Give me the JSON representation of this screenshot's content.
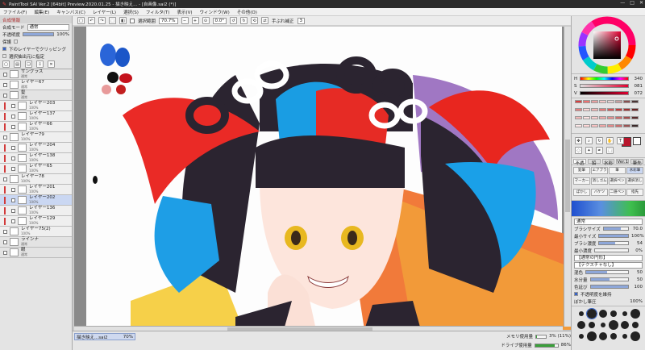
{
  "titlebar": {
    "title": "PaintTool SAI Ver.2 [64bit] Preview.2020.01.25 - 描き映え... - [自画像.sai2 (*)]",
    "min": "—",
    "max": "□",
    "close": "✕"
  },
  "menu": [
    "ファイル(F)",
    "編集(E)",
    "キャンバス(C)",
    "レイヤー(L)",
    "選択(S)",
    "フィルタ(T)",
    "表示(V)",
    "ウィンドウ(W)",
    "その他(O)"
  ],
  "toolbar": {
    "selection_label": "選択範囲",
    "zoom": "70.7%",
    "angle": "0.0°",
    "stabilizer_label": "手ぶれ補正",
    "stabilizer_value": "3"
  },
  "left_panel": {
    "header": "合成情報",
    "blend_label": "合成モード",
    "blend_value": "通常",
    "opacity_label": "不透明度",
    "opacity_value": "100%",
    "guard_label": "保護",
    "clip_label": "下のレイヤーでクリッピング",
    "select_src_label": "選択抽出元に指定",
    "layers": [
      {
        "name": "サングラス",
        "sub": "通常",
        "kind": "folder"
      },
      {
        "name": "レイヤー67",
        "sub": "通常",
        "kind": "normal"
      },
      {
        "name": "髪",
        "sub": "通常",
        "kind": "folder"
      },
      {
        "name": "レイヤー203",
        "sub": "100%",
        "kind": "clip"
      },
      {
        "name": "レイヤー137",
        "sub": "100%",
        "kind": "clip"
      },
      {
        "name": "レイヤー66",
        "sub": "100%",
        "kind": "clip"
      },
      {
        "name": "レイヤー79",
        "sub": "100%",
        "kind": "normal"
      },
      {
        "name": "レイヤー204",
        "sub": "100%",
        "kind": "clip"
      },
      {
        "name": "レイヤー138",
        "sub": "100%",
        "kind": "clip"
      },
      {
        "name": "レイヤー65",
        "sub": "100%",
        "kind": "clip"
      },
      {
        "name": "レイヤー78",
        "sub": "100%",
        "kind": "normal"
      },
      {
        "name": "レイヤー201",
        "sub": "100%",
        "kind": "clip"
      },
      {
        "name": "レイヤー202",
        "sub": "100%",
        "kind": "selected"
      },
      {
        "name": "レイヤー136",
        "sub": "100%",
        "kind": "clip"
      },
      {
        "name": "レイヤー129",
        "sub": "100%",
        "kind": "clip"
      },
      {
        "name": "レイヤー75(2)",
        "sub": "100%",
        "kind": "normal"
      },
      {
        "name": "ラインナ",
        "sub": "通常",
        "kind": "folder"
      },
      {
        "name": "眼",
        "sub": "通常",
        "kind": "folder"
      }
    ]
  },
  "status": {
    "doc_tab": "描き映え...sai2",
    "doc_zoom": "70%",
    "memory_label": "メモリ使用量",
    "memory_value": "3% (11%)",
    "drive_label": "ドライブ使用量",
    "drive_value": "86%"
  },
  "right_panel": {
    "h_label": "H",
    "h_value": "340",
    "s_label": "S",
    "s_value": "081",
    "v_label": "V",
    "v_value": "072",
    "tool_tabs": [
      "不透明",
      "鉛",
      "水彩",
      "Ver.1",
      "筆先"
    ],
    "tools": [
      "鉛筆",
      "エアブラシ",
      "筆",
      "水彩筆",
      "マーカー",
      "消しゴム",
      "選択ペン",
      "選択消し",
      "ぼかし",
      "バケツ",
      "二値ペン",
      "指先"
    ],
    "brush_mode_label": "通常",
    "size_label": "ブラシサイズ",
    "size_value": "70.0",
    "min_size_label": "最小サイズ",
    "min_size_value": "100%",
    "density_label": "ブラシ濃度",
    "density_value": "54",
    "min_density_label": "最小濃度",
    "min_density_value": "0%",
    "paper_label": "【通常の円形】",
    "texture_label": "【テクスチャなし】",
    "blend_label": "混色",
    "blend_value": "50",
    "water_label": "水分量",
    "water_value": "50",
    "color_stretch_label": "色延び",
    "color_stretch_value": "100",
    "keep_opacity_label": "不透明度を維持",
    "blur_label": "ぼかし筆圧",
    "blur_value": "100%"
  },
  "colors": {
    "accent": "#2f5fbf",
    "current_color": "#b8162c",
    "secondary_color": "#ffffff",
    "palette": [
      "#d93f3f",
      "#f07070",
      "#e8a0a0",
      "#f4c6c6",
      "#e6d0d0",
      "#c9a0a0",
      "#8a4f4f",
      "#4c3636",
      "#e88080",
      "#fdd2d2",
      "#f3b5b5",
      "#e77a7a",
      "#d65555",
      "#c03a3a",
      "#9f2e2e",
      "#6b2121",
      "#f2b8b8",
      "#fde2e2",
      "#fbcfcf",
      "#f0aaaa",
      "#e58f8f",
      "#cc6b6b",
      "#a64d4d",
      "#5a2a2a",
      "#ffe9e9",
      "#ffd8d8",
      "#f9c3c3",
      "#f1a7a7",
      "#e48a8a",
      "#cd6e6e",
      "#9b5252",
      "#3b2a2a"
    ]
  }
}
